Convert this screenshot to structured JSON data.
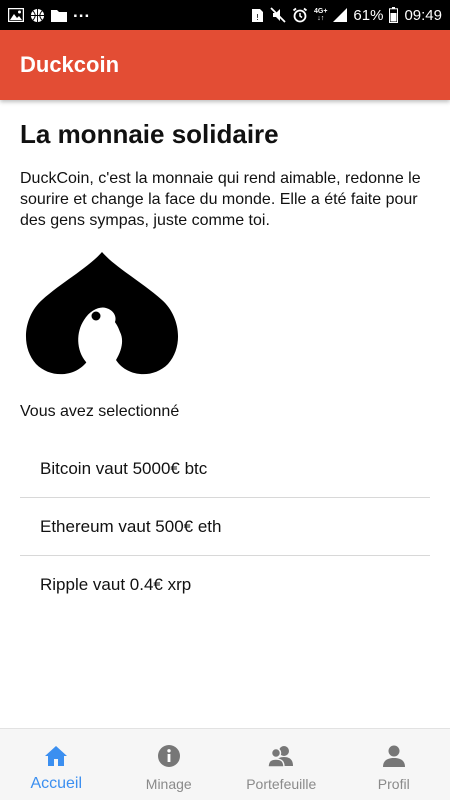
{
  "status_bar": {
    "battery": "61%",
    "time": "09:49",
    "network": "4G+",
    "overflow": "...",
    "icons": [
      "image-icon",
      "basketball-icon",
      "folder-icon",
      "sim-icon",
      "mute-icon",
      "alarm-icon",
      "signal-icon",
      "battery-icon"
    ]
  },
  "app_bar": {
    "title": "Duckcoin",
    "color": "#e34d34"
  },
  "main": {
    "title": "La monnaie solidaire",
    "intro": "DuckCoin, c'est la monnaie qui rend aimable, redonne le sourire et change la face du monde. Elle a été faite pour des gens sympas, juste comme toi.",
    "logo_icon": "duck-heart-logo",
    "selected_label": "Vous avez selectionné",
    "currencies": [
      {
        "label": "Bitcoin vaut 5000€ btc"
      },
      {
        "label": "Ethereum vaut 500€ eth"
      },
      {
        "label": "Ripple vaut 0.4€ xrp"
      }
    ]
  },
  "bottom_nav": {
    "active_color": "#3b8ff0",
    "inactive_color": "#8a8a8a",
    "items": [
      {
        "label": "Accueil",
        "icon": "home-icon",
        "active": true
      },
      {
        "label": "Minage",
        "icon": "info-icon",
        "active": false
      },
      {
        "label": "Portefeuille",
        "icon": "people-icon",
        "active": false
      },
      {
        "label": "Profil",
        "icon": "person-icon",
        "active": false
      }
    ]
  }
}
